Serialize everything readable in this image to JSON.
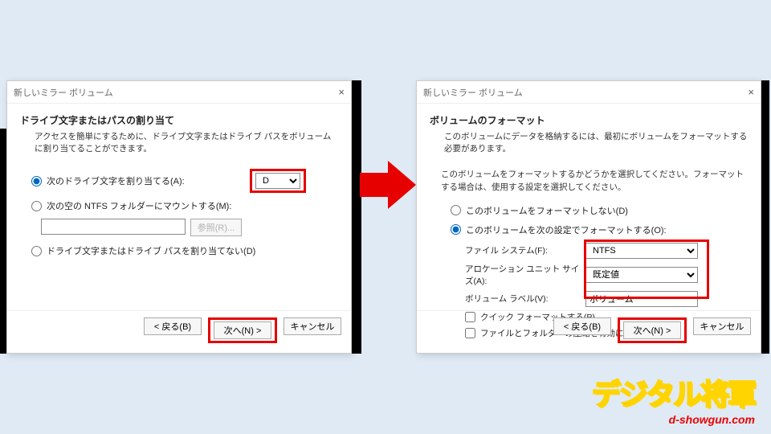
{
  "dialogLeft": {
    "title": "新しいミラー ボリューム",
    "heading": "ドライブ文字またはパスの割り当て",
    "subtext": "アクセスを簡単にするために、ドライブ文字またはドライブ パスをボリュームに割り当てることができます。",
    "optAssign": "次のドライブ文字を割り当てる(A):",
    "driveLetter": "D",
    "optMount": "次の空の NTFS フォルダーにマウントする(M):",
    "browseBtn": "参照(R)...",
    "optNone": "ドライブ文字またはドライブ パスを割り当てない(D)",
    "back": "< 戻る(B)",
    "next": "次へ(N) >",
    "cancel": "キャンセル"
  },
  "dialogRight": {
    "title": "新しいミラー ボリューム",
    "heading": "ボリュームのフォーマット",
    "subtext": "このボリュームにデータを格納するには、最初にボリュームをフォーマットする必要があります。",
    "instruct": "このボリュームをフォーマットするかどうかを選択してください。フォーマットする場合は、使用する設定を選択してください。",
    "optNoFmt": "このボリュームをフォーマットしない(D)",
    "optFmt": "このボリュームを次の設定でフォーマットする(O):",
    "fsLabel": "ファイル システム(F):",
    "fsValue": "NTFS",
    "allocLabel": "アロケーション ユニット サイズ(A):",
    "allocValue": "既定値",
    "volLabel": "ボリューム ラベル(V):",
    "volValue": "ボリューム",
    "quickFmt": "クイック フォーマットする(P)",
    "compress": "ファイルとフォルダーの圧縮を有効にする(E)",
    "back": "< 戻る(B)",
    "next": "次へ(N) >",
    "cancel": "キャンセル"
  },
  "logo": {
    "main": "デジタル将軍",
    "sub": "d-showgun.com"
  }
}
